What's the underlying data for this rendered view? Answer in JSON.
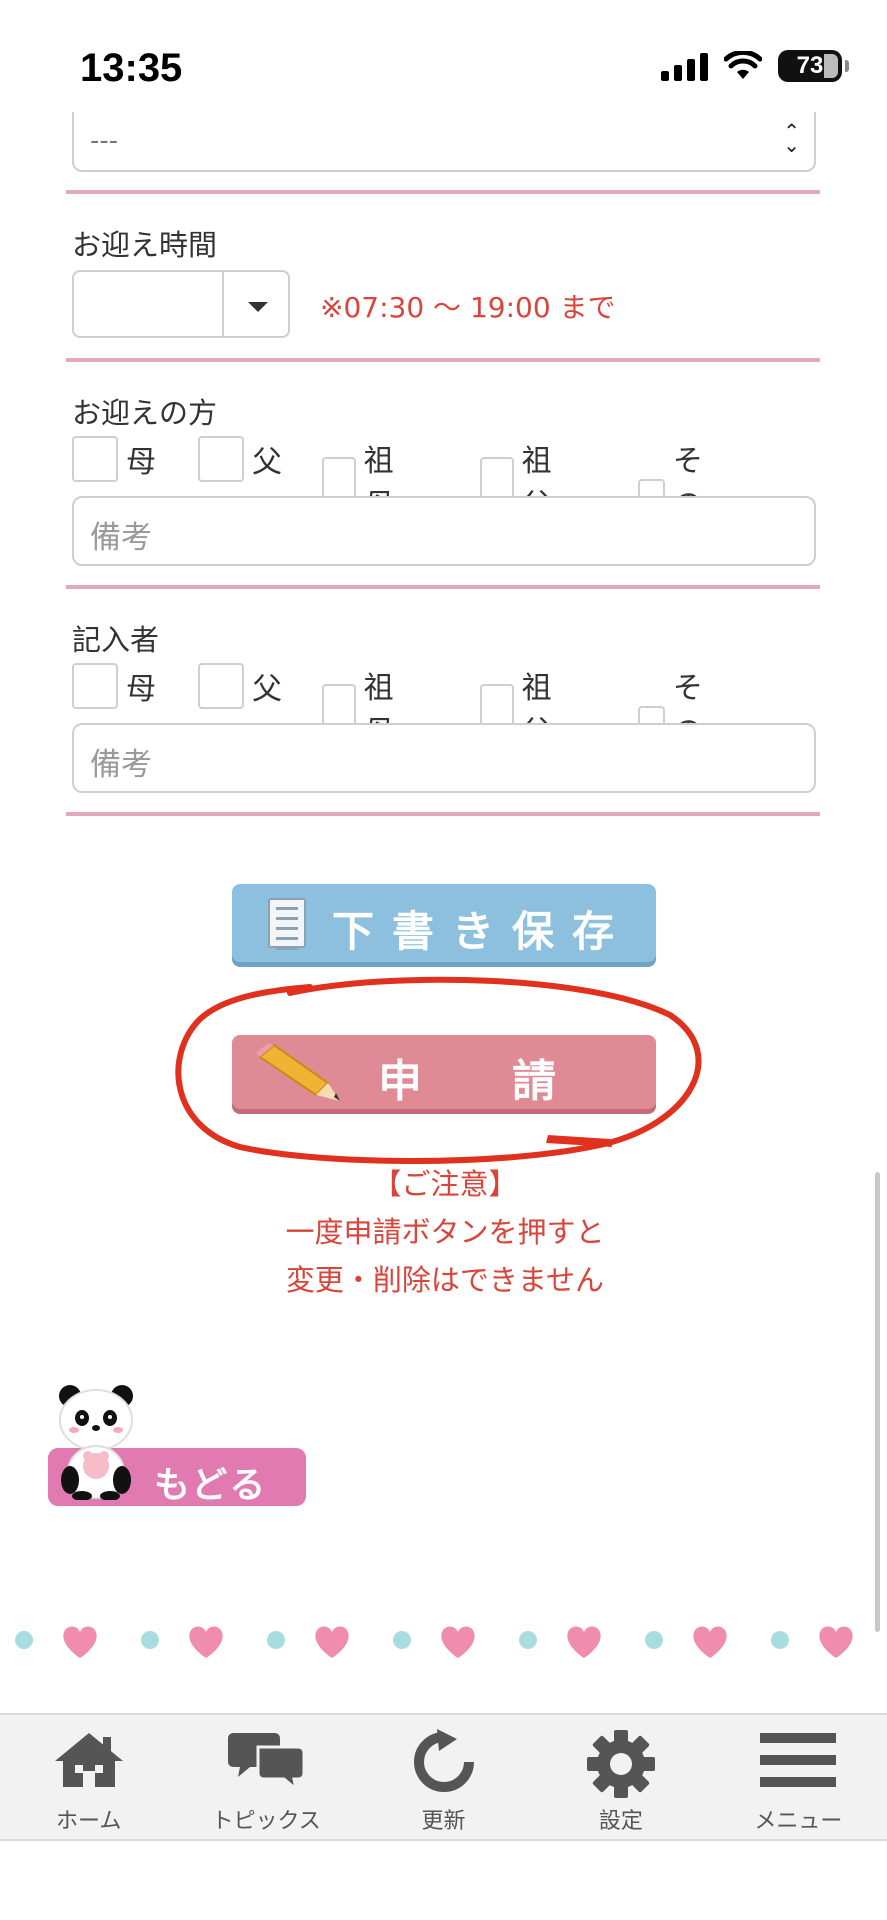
{
  "status_bar": {
    "time": "13:35",
    "battery": "73"
  },
  "form": {
    "select_value": "---",
    "pickup_time": {
      "label": "お迎え時間",
      "note": "※07:30 ～ 19:00 まで"
    },
    "pickup_person": {
      "label": "お迎えの方",
      "options": [
        "母",
        "父",
        "祖母",
        "祖父",
        "その他"
      ],
      "memo_placeholder": "備考"
    },
    "writer": {
      "label": "記入者",
      "options": [
        "母",
        "父",
        "祖母",
        "祖父",
        "その他"
      ],
      "memo_placeholder": "備考"
    }
  },
  "buttons": {
    "draft": "下書き保存",
    "apply": "申請",
    "back": "もどる"
  },
  "notice": {
    "title": "【ご注意】",
    "line1": "一度申請ボタンを押すと",
    "line2": "変更・削除はできません"
  },
  "tab_bar": [
    {
      "label": "ホーム",
      "icon": "home-icon"
    },
    {
      "label": "トピックス",
      "icon": "chat-bubbles-icon"
    },
    {
      "label": "更新",
      "icon": "refresh-icon"
    },
    {
      "label": "設定",
      "icon": "gear-icon"
    },
    {
      "label": "メニュー",
      "icon": "hamburger-menu-icon"
    }
  ],
  "colors": {
    "accent_pink": "#e3a9bd",
    "notice_red": "#d9453a",
    "draft_blue": "#8dc0df",
    "apply_pink": "#df8a95",
    "back_pink": "#e17ab0"
  }
}
